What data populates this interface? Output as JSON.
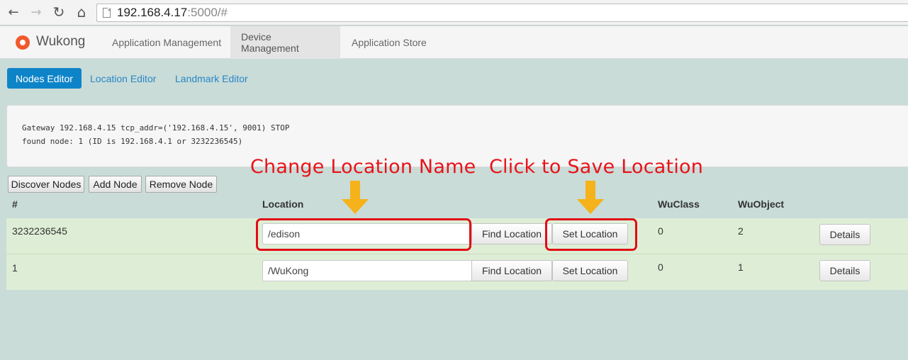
{
  "browser": {
    "back_glyph": "←",
    "forward_glyph": "→",
    "reload_glyph": "↻",
    "home_glyph": "⌂",
    "url_host": "192.168.4.17",
    "url_rest": ":5000/#"
  },
  "navbar": {
    "brand": "Wukong",
    "tabs": [
      {
        "label": "Application Management",
        "active": false
      },
      {
        "label": "Device Management",
        "active": true
      },
      {
        "label": "Application Store",
        "active": false
      }
    ]
  },
  "subtabs": [
    {
      "label": "Nodes Editor",
      "active": true
    },
    {
      "label": "Location Editor",
      "active": false
    },
    {
      "label": "Landmark Editor",
      "active": false
    }
  ],
  "console": {
    "lines": [
      "Gateway 192.168.4.15 tcp_addr=('192.168.4.15', 9001) STOP",
      "found node: 1 (ID is 192.168.4.1 or 3232236545)"
    ]
  },
  "toolbar": {
    "discover_label": "Discover Nodes",
    "add_label": "Add Node",
    "remove_label": "Remove Node"
  },
  "table": {
    "headers": {
      "id": "#",
      "location": "Location",
      "wuclass": "WuClass",
      "wuobject": "WuObject"
    },
    "rows": [
      {
        "id": "3232236545",
        "location": "/edison",
        "find_label": "Find Location",
        "set_label": "Set Location",
        "wuclass": "0",
        "wuobject": "2",
        "details_label": "Details"
      },
      {
        "id": "1",
        "location": "/WuKong",
        "find_label": "Find Location",
        "set_label": "Set Location",
        "wuclass": "0",
        "wuobject": "1",
        "details_label": "Details"
      }
    ]
  },
  "annotations": {
    "change_location": "Change Location Name",
    "save_location": "Click to Save Location"
  },
  "colors": {
    "page_bg": "#c9dcd8",
    "primary": "#0e84c8",
    "row_bg": "#deeed6",
    "annotation_red": "#e8141a",
    "arrow_orange": "#f5b21a"
  }
}
